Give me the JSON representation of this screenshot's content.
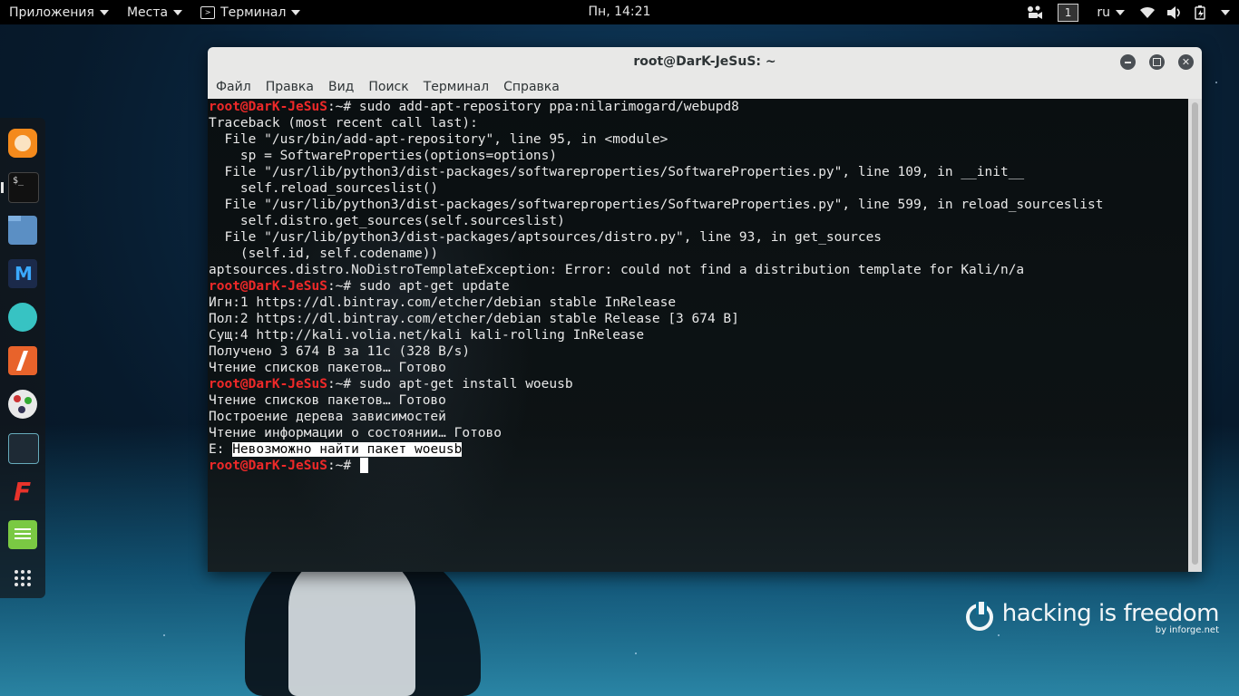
{
  "topbar": {
    "applications": "Приложения",
    "places": "Места",
    "active_app": "Терминал",
    "clock": "Пн, 14:21",
    "workspace": "1",
    "language": "ru"
  },
  "dock": {
    "items": [
      "firefox-icon",
      "terminal-icon",
      "files-icon",
      "maltego-icon",
      "avatar-app-icon",
      "burpsuite-icon",
      "armitage-icon",
      "beef-icon",
      "faraday-icon",
      "notes-icon",
      "show-apps-icon"
    ]
  },
  "window": {
    "title": "root@DarK-JeSuS: ~",
    "menu": [
      "Файл",
      "Правка",
      "Вид",
      "Поиск",
      "Терминал",
      "Справка"
    ]
  },
  "terminal": {
    "prompt": "root@DarK-JeSuS",
    "prompt_suffix": ":~# ",
    "lines": [
      {
        "type": "cmd",
        "text": "sudo add-apt-repository ppa:nilarimogard/webupd8"
      },
      {
        "type": "out",
        "text": "Traceback (most recent call last):"
      },
      {
        "type": "out",
        "text": "  File \"/usr/bin/add-apt-repository\", line 95, in <module>"
      },
      {
        "type": "out",
        "text": "    sp = SoftwareProperties(options=options)"
      },
      {
        "type": "out",
        "text": "  File \"/usr/lib/python3/dist-packages/softwareproperties/SoftwareProperties.py\", line 109, in __init__"
      },
      {
        "type": "out",
        "text": "    self.reload_sourceslist()"
      },
      {
        "type": "out",
        "text": "  File \"/usr/lib/python3/dist-packages/softwareproperties/SoftwareProperties.py\", line 599, in reload_sourceslist"
      },
      {
        "type": "out",
        "text": "    self.distro.get_sources(self.sourceslist)"
      },
      {
        "type": "out",
        "text": "  File \"/usr/lib/python3/dist-packages/aptsources/distro.py\", line 93, in get_sources"
      },
      {
        "type": "out",
        "text": "    (self.id, self.codename))"
      },
      {
        "type": "out",
        "text": "aptsources.distro.NoDistroTemplateException: Error: could not find a distribution template for Kali/n/a"
      },
      {
        "type": "cmd",
        "text": "sudo apt-get update"
      },
      {
        "type": "out",
        "text": "Игн:1 https://dl.bintray.com/etcher/debian stable InRelease"
      },
      {
        "type": "out",
        "text": "Пол:2 https://dl.bintray.com/etcher/debian stable Release [3 674 B]"
      },
      {
        "type": "out",
        "text": "Сущ:4 http://kali.volia.net/kali kali-rolling InRelease"
      },
      {
        "type": "out",
        "text": "Получено 3 674 B за 11с (328 B/s)"
      },
      {
        "type": "out",
        "text": "Чтение списков пакетов… Готово"
      },
      {
        "type": "cmd",
        "text": "sudo apt-get install woeusb"
      },
      {
        "type": "out",
        "text": "Чтение списков пакетов… Готово"
      },
      {
        "type": "out",
        "text": "Построение дерева зависимостей"
      },
      {
        "type": "out",
        "text": "Чтение информации о состоянии… Готово"
      },
      {
        "type": "err",
        "prefix": "E: ",
        "text": "Невозможно найти пакет woeusb"
      },
      {
        "type": "cursor",
        "text": ""
      }
    ]
  },
  "watermark": {
    "text": "hacking is freedom",
    "by": "by inforge.net"
  }
}
